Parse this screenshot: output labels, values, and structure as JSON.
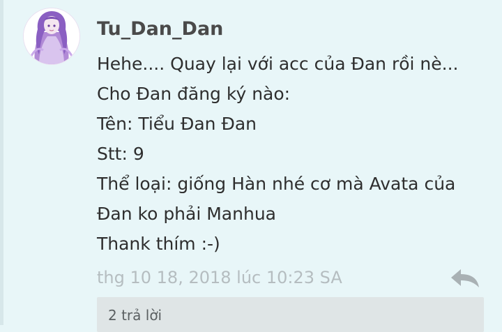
{
  "comment": {
    "username": "Tu_Dan_Dan",
    "lines": [
      "Hehe.... Quay lại với acc của Đan rồi nè...",
      "Cho Đan đăng ký nào:",
      "Tên: Tiểu Đan Đan",
      "Stt: 9",
      "Thể loại: giống Hàn nhé cơ mà Avata của",
      "Đan ko phải Manhua",
      "Thank thím :-)"
    ],
    "timestamp": "thg 10 18, 2018 lúc 10:23 SA",
    "reply_icon": "reply-arrow-icon",
    "replies_label": "2 trả lời"
  },
  "colors": {
    "background": "#e8f6f8",
    "username": "#4a4a4a",
    "text": "#2e2e2e",
    "meta": "#b5bdc0",
    "replies_box": "#dfe5e6"
  }
}
